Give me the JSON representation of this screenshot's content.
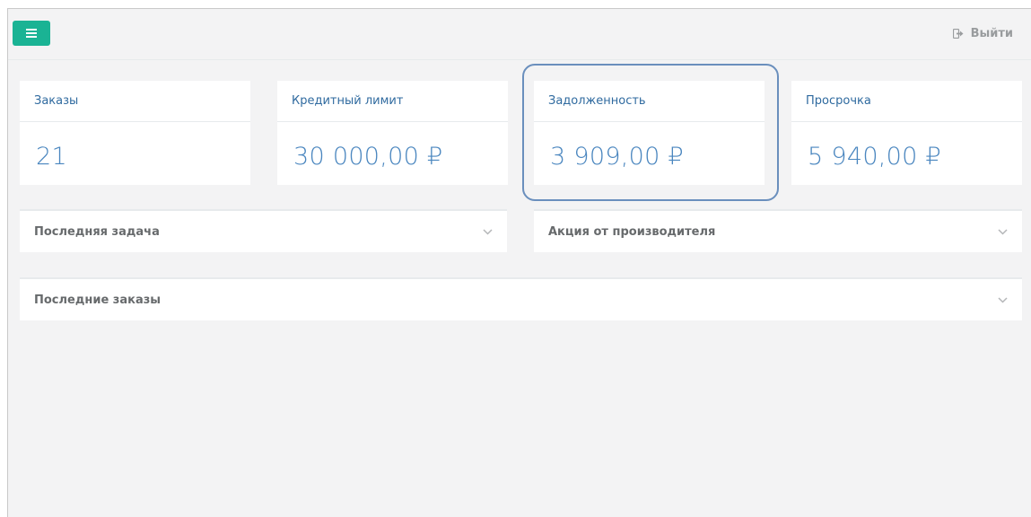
{
  "header": {
    "menu_icon": "hamburger-icon",
    "logout_icon": "sign-out-icon",
    "logout_label": "Выйти",
    "accent_color": "#1ab394"
  },
  "cards": [
    {
      "title": "Заказы",
      "value": "21"
    },
    {
      "title": "Кредитный лимит",
      "value": "30 000,00 ₽"
    },
    {
      "title": "Задолженность",
      "value": "3 909,00 ₽"
    },
    {
      "title": "Просрочка",
      "value": "5 940,00 ₽"
    }
  ],
  "panels": [
    {
      "title": "Последняя задача",
      "icon": "chevron-down-icon"
    },
    {
      "title": "Акция от производителя",
      "icon": "chevron-down-icon"
    },
    {
      "title": "Последние заказы",
      "icon": "chevron-down-icon"
    }
  ],
  "colors": {
    "card_title": "#2f6a9f",
    "card_value": "#4a86bf",
    "highlight_border": "#6a8fbd",
    "background": "#f3f3f4"
  }
}
